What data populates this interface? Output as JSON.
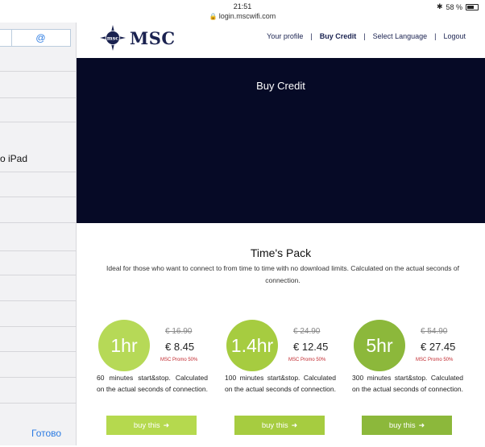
{
  "status_bar": {
    "time": "21:51",
    "url": "login.mscwifi.com",
    "battery": "58 %"
  },
  "left_panel": {
    "at_symbol": "@",
    "item_label": "o iPad",
    "done_label": "Готово"
  },
  "header": {
    "logo_text": "MSC",
    "logo_mark_text": "msc",
    "nav": [
      {
        "label": "Your profile"
      },
      {
        "label": "Buy Credit"
      },
      {
        "label": "Select Language"
      },
      {
        "label": "Logout"
      }
    ],
    "separator": "|"
  },
  "hero": {
    "title": "Buy Credit"
  },
  "pack": {
    "title": "Time's Pack",
    "description": "Ideal for those who want to connect to from time to time with no download limits. Calculated on the actual seconds of connection."
  },
  "cards": [
    {
      "duration": "1hr",
      "old_price": "€ 16.90",
      "new_price": "€ 8.45",
      "promo": "MSC Promo 50%",
      "description": "60 minutes start&stop. Calculated on the actual seconds of connection.",
      "button": "buy this",
      "circle_color": "#b6d957",
      "button_color": "#b5d94e"
    },
    {
      "duration": "1.4hr",
      "old_price": "€ 24.90",
      "new_price": "€ 12.45",
      "promo": "MSC Promo 50%",
      "description": "100 minutes start&stop. Calculated on the actual seconds of connection.",
      "button": "buy this",
      "circle_color": "#a6cc40",
      "button_color": "#a6cc40"
    },
    {
      "duration": "5hr",
      "old_price": "€ 54.90",
      "new_price": "€ 27.45",
      "promo": "MSC Promo 50%",
      "description": "300 minutes start&stop. Calculated on the actual seconds of connection.",
      "button": "buy this",
      "circle_color": "#8cb83b",
      "button_color": "#8cb83b"
    }
  ],
  "colors": {
    "hero_bg": "#060a26",
    "brand": "#1a2250",
    "promo": "#c1272d",
    "link": "#2a7ae2"
  }
}
